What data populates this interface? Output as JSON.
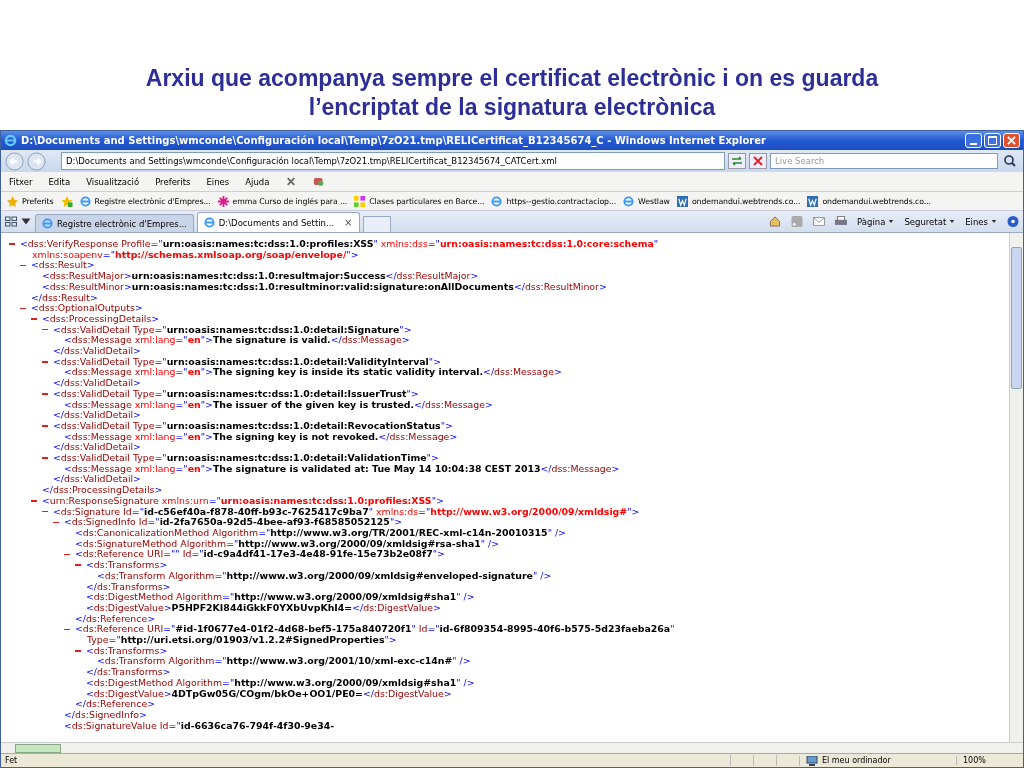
{
  "slide": {
    "title_lines": [
      "Arxiu que acompanya sempre el certificat electrònic i on es guarda",
      "l’encriptat de la signatura electrònica"
    ]
  },
  "browser": {
    "title": "D:\\Documents and Settings\\wmconde\\Configuración local\\Temp\\7zO21.tmp\\RELICertificat_B12345674_C - Windows Internet Explorer",
    "address": "D:\\Documents and Settings\\wmconde\\Configuración local\\Temp\\7zO21.tmp\\RELICertificat_B12345674_CATCert.xml",
    "search": {
      "placeholder": "Live Search"
    },
    "menu": [
      "Fitxer",
      "Edita",
      "Visualització",
      "Preferits",
      "Eines",
      "Ajuda"
    ],
    "favorites_button": "Preferits",
    "favorites": [
      {
        "label": "Registre electrònic d'Empres...",
        "kind": "page"
      },
      {
        "label": "emma Curso de inglés para ...",
        "kind": "asterisk"
      },
      {
        "label": "Clases particulares en Barce...",
        "kind": "squares"
      },
      {
        "label": "https--gestio.contractaciop...",
        "kind": "page"
      },
      {
        "label": "Westlaw",
        "kind": "page"
      },
      {
        "label": "ondemandui.webtrends.co...",
        "kind": "w"
      },
      {
        "label": "ondemandui.webtrends.co...",
        "kind": "w"
      }
    ],
    "tabs": [
      {
        "label": "Registre electrònic d'Empres...",
        "selected": false
      },
      {
        "label": "D:\\Documents and Settin...",
        "selected": true,
        "close": "×"
      }
    ],
    "commands": [
      "Pàgina",
      "Seguretat",
      "Eines"
    ],
    "status_bar": {
      "text": "Fet",
      "zone": "El meu ordinador",
      "zoom": "100%"
    }
  },
  "document": {
    "nodes": [
      {
        "expanded": true,
        "open": [
          [
            {
              "m": "<"
            },
            {
              "n": "dss:VerifyResponse"
            },
            {
              "a": " Profile"
            },
            {
              "m": "=\""
            },
            {
              "v": "urn:oasis:names:tc:dss:1.0:profiles:XSS"
            },
            {
              "m": "\""
            },
            {
              "x": " xmlns:dss"
            },
            {
              "m": "=\""
            },
            {
              "r": "urn:oasis:names:tc:dss:1.0:core:schema"
            },
            {
              "m": "\""
            }
          ],
          [
            {
              "x": "xmlns:soapenv"
            },
            {
              "m": "=\""
            },
            {
              "r": "http://schemas.xmlsoap.org/soap/envelope/"
            },
            {
              "m": "\">"
            }
          ]
        ],
        "children": [
          {
            "expanded": true,
            "open": [
              [
                {
                  "m": "<"
                },
                {
                  "n": "dss:Result"
                },
                {
                  "m": ">"
                }
              ]
            ],
            "children": [
              {
                "open": [
                  [
                    {
                      "m": "<"
                    },
                    {
                      "n": "dss:ResultMajor"
                    },
                    {
                      "m": ">"
                    },
                    {
                      "t": "urn:oasis:names:tc:dss:1.0:resultmajor:Success"
                    },
                    {
                      "m": "</"
                    },
                    {
                      "n": "dss:ResultMajor"
                    },
                    {
                      "m": ">"
                    }
                  ]
                ]
              },
              {
                "open": [
                  [
                    {
                      "m": "<"
                    },
                    {
                      "n": "dss:ResultMinor"
                    },
                    {
                      "m": ">"
                    },
                    {
                      "t": "urn:oasis:names:tc:dss:1.0:resultminor:valid:signature:onAllDocuments"
                    },
                    {
                      "m": "</"
                    },
                    {
                      "n": "dss:ResultMinor"
                    },
                    {
                      "m": ">"
                    }
                  ]
                ]
              }
            ],
            "close": [
              {
                "m": "</"
              },
              {
                "n": "dss:Result"
              },
              {
                "m": ">"
              }
            ]
          },
          {
            "expanded": true,
            "open": [
              [
                {
                  "m": "<"
                },
                {
                  "n": "dss:OptionalOutputs"
                },
                {
                  "m": ">"
                }
              ]
            ],
            "children": [
              {
                "expanded": true,
                "open": [
                  [
                    {
                      "m": "<"
                    },
                    {
                      "n": "dss:ProcessingDetails"
                    },
                    {
                      "m": ">"
                    }
                  ]
                ],
                "children": [
                  {
                    "expanded": true,
                    "open": [
                      [
                        {
                          "m": "<"
                        },
                        {
                          "n": "dss:ValidDetail"
                        },
                        {
                          "a": " Type"
                        },
                        {
                          "m": "=\""
                        },
                        {
                          "v": "urn:oasis:names:tc:dss:1.0:detail:Signature"
                        },
                        {
                          "m": "\">"
                        }
                      ]
                    ],
                    "children": [
                      {
                        "open": [
                          [
                            {
                              "m": "<"
                            },
                            {
                              "n": "dss:Message"
                            },
                            {
                              "x": " xml:lang"
                            },
                            {
                              "m": "=\""
                            },
                            {
                              "r": "en"
                            },
                            {
                              "m": "\">"
                            },
                            {
                              "t": "The signature is valid."
                            },
                            {
                              "m": "</"
                            },
                            {
                              "n": "dss:Message"
                            },
                            {
                              "m": ">"
                            }
                          ]
                        ]
                      }
                    ],
                    "close": [
                      {
                        "m": "</"
                      },
                      {
                        "n": "dss:ValidDetail"
                      },
                      {
                        "m": ">"
                      }
                    ]
                  },
                  {
                    "expanded": true,
                    "open": [
                      [
                        {
                          "m": "<"
                        },
                        {
                          "n": "dss:ValidDetail"
                        },
                        {
                          "a": " Type"
                        },
                        {
                          "m": "=\""
                        },
                        {
                          "v": "urn:oasis:names:tc:dss:1.0:detail:ValidityInterval"
                        },
                        {
                          "m": "\">"
                        }
                      ]
                    ],
                    "children": [
                      {
                        "open": [
                          [
                            {
                              "m": "<"
                            },
                            {
                              "n": "dss:Message"
                            },
                            {
                              "x": " xml:lang"
                            },
                            {
                              "m": "=\""
                            },
                            {
                              "r": "en"
                            },
                            {
                              "m": "\">"
                            },
                            {
                              "t": "The signing key is inside its static validity interval."
                            },
                            {
                              "m": "</"
                            },
                            {
                              "n": "dss:Message"
                            },
                            {
                              "m": ">"
                            }
                          ]
                        ]
                      }
                    ],
                    "close": [
                      {
                        "m": "</"
                      },
                      {
                        "n": "dss:ValidDetail"
                      },
                      {
                        "m": ">"
                      }
                    ]
                  },
                  {
                    "expanded": true,
                    "open": [
                      [
                        {
                          "m": "<"
                        },
                        {
                          "n": "dss:ValidDetail"
                        },
                        {
                          "a": " Type"
                        },
                        {
                          "m": "=\""
                        },
                        {
                          "v": "urn:oasis:names:tc:dss:1.0:detail:IssuerTrust"
                        },
                        {
                          "m": "\">"
                        }
                      ]
                    ],
                    "children": [
                      {
                        "open": [
                          [
                            {
                              "m": "<"
                            },
                            {
                              "n": "dss:Message"
                            },
                            {
                              "x": " xml:lang"
                            },
                            {
                              "m": "=\""
                            },
                            {
                              "r": "en"
                            },
                            {
                              "m": "\">"
                            },
                            {
                              "t": "The issuer of the given key is trusted."
                            },
                            {
                              "m": "</"
                            },
                            {
                              "n": "dss:Message"
                            },
                            {
                              "m": ">"
                            }
                          ]
                        ]
                      }
                    ],
                    "close": [
                      {
                        "m": "</"
                      },
                      {
                        "n": "dss:ValidDetail"
                      },
                      {
                        "m": ">"
                      }
                    ]
                  },
                  {
                    "expanded": true,
                    "open": [
                      [
                        {
                          "m": "<"
                        },
                        {
                          "n": "dss:ValidDetail"
                        },
                        {
                          "a": " Type"
                        },
                        {
                          "m": "=\""
                        },
                        {
                          "v": "urn:oasis:names:tc:dss:1.0:detail:RevocationStatus"
                        },
                        {
                          "m": "\">"
                        }
                      ]
                    ],
                    "children": [
                      {
                        "open": [
                          [
                            {
                              "m": "<"
                            },
                            {
                              "n": "dss:Message"
                            },
                            {
                              "x": " xml:lang"
                            },
                            {
                              "m": "=\""
                            },
                            {
                              "r": "en"
                            },
                            {
                              "m": "\">"
                            },
                            {
                              "t": "The signing key is not revoked."
                            },
                            {
                              "m": "</"
                            },
                            {
                              "n": "dss:Message"
                            },
                            {
                              "m": ">"
                            }
                          ]
                        ]
                      }
                    ],
                    "close": [
                      {
                        "m": "</"
                      },
                      {
                        "n": "dss:ValidDetail"
                      },
                      {
                        "m": ">"
                      }
                    ]
                  },
                  {
                    "expanded": true,
                    "open": [
                      [
                        {
                          "m": "<"
                        },
                        {
                          "n": "dss:ValidDetail"
                        },
                        {
                          "a": " Type"
                        },
                        {
                          "m": "=\""
                        },
                        {
                          "v": "urn:oasis:names:tc:dss:1.0:detail:ValidationTime"
                        },
                        {
                          "m": "\">"
                        }
                      ]
                    ],
                    "children": [
                      {
                        "open": [
                          [
                            {
                              "m": "<"
                            },
                            {
                              "n": "dss:Message"
                            },
                            {
                              "x": " xml:lang"
                            },
                            {
                              "m": "=\""
                            },
                            {
                              "r": "en"
                            },
                            {
                              "m": "\">"
                            },
                            {
                              "t": "The signature is validated at: Tue May 14 10:04:38 CEST 2013"
                            },
                            {
                              "m": "</"
                            },
                            {
                              "n": "dss:Message"
                            },
                            {
                              "m": ">"
                            }
                          ]
                        ]
                      }
                    ],
                    "close": [
                      {
                        "m": "</"
                      },
                      {
                        "n": "dss:ValidDetail"
                      },
                      {
                        "m": ">"
                      }
                    ]
                  }
                ],
                "close": [
                  {
                    "m": "</"
                  },
                  {
                    "n": "dss:ProcessingDetails"
                  },
                  {
                    "m": ">"
                  }
                ]
              },
              {
                "expanded": true,
                "open": [
                  [
                    {
                      "m": "<"
                    },
                    {
                      "n": "urn:ResponseSignature"
                    },
                    {
                      "x": " xmlns:urn"
                    },
                    {
                      "m": "=\""
                    },
                    {
                      "r": "urn:oasis:names:tc:dss:1.0:profiles:XSS"
                    },
                    {
                      "m": "\">"
                    }
                  ]
                ],
                "children": [
                  {
                    "expanded": true,
                    "open": [
                      [
                        {
                          "m": "<"
                        },
                        {
                          "n": "ds:Signature"
                        },
                        {
                          "a": " Id"
                        },
                        {
                          "m": "=\""
                        },
                        {
                          "v": "id-c56ef40a-f878-40ff-b93c-7625417c9ba7"
                        },
                        {
                          "m": "\""
                        },
                        {
                          "x": " xmlns:ds"
                        },
                        {
                          "m": "=\""
                        },
                        {
                          "r": "http://www.w3.org/2000/09/xmldsig#"
                        },
                        {
                          "m": "\">"
                        }
                      ]
                    ],
                    "children": [
                      {
                        "expanded": true,
                        "open": [
                          [
                            {
                              "m": "<"
                            },
                            {
                              "n": "ds:SignedInfo"
                            },
                            {
                              "a": " Id"
                            },
                            {
                              "m": "=\""
                            },
                            {
                              "v": "id-2fa7650a-92d5-4bee-af93-f68585052125"
                            },
                            {
                              "m": "\">"
                            }
                          ]
                        ],
                        "children": [
                          {
                            "open": [
                              [
                                {
                                  "m": "<"
                                },
                                {
                                  "n": "ds:CanonicalizationMethod"
                                },
                                {
                                  "a": " Algorithm"
                                },
                                {
                                  "m": "=\""
                                },
                                {
                                  "v": "http://www.w3.org/TR/2001/REC-xml-c14n-20010315"
                                },
                                {
                                  "m": "\" />"
                                }
                              ]
                            ]
                          },
                          {
                            "open": [
                              [
                                {
                                  "m": "<"
                                },
                                {
                                  "n": "ds:SignatureMethod"
                                },
                                {
                                  "a": " Algorithm"
                                },
                                {
                                  "m": "=\""
                                },
                                {
                                  "v": "http://www.w3.org/2000/09/xmldsig#rsa-sha1"
                                },
                                {
                                  "m": "\" />"
                                }
                              ]
                            ]
                          },
                          {
                            "expanded": true,
                            "open": [
                              [
                                {
                                  "m": "<"
                                },
                                {
                                  "n": "ds:Reference"
                                },
                                {
                                  "a": " URI"
                                },
                                {
                                  "m": "=\"\""
                                },
                                {
                                  "a": " Id"
                                },
                                {
                                  "m": "=\""
                                },
                                {
                                  "v": "id-c9a4df41-17e3-4e48-91fe-15e73b2e08f7"
                                },
                                {
                                  "m": "\">"
                                }
                              ]
                            ],
                            "children": [
                              {
                                "expanded": true,
                                "open": [
                                  [
                                    {
                                      "m": "<"
                                    },
                                    {
                                      "n": "ds:Transforms"
                                    },
                                    {
                                      "m": ">"
                                    }
                                  ]
                                ],
                                "children": [
                                  {
                                    "open": [
                                      [
                                        {
                                          "m": "<"
                                        },
                                        {
                                          "n": "ds:Transform"
                                        },
                                        {
                                          "a": " Algorithm"
                                        },
                                        {
                                          "m": "=\""
                                        },
                                        {
                                          "v": "http://www.w3.org/2000/09/xmldsig#enveloped-signature"
                                        },
                                        {
                                          "m": "\" />"
                                        }
                                      ]
                                    ]
                                  }
                                ],
                                "close": [
                                  {
                                    "m": "</"
                                  },
                                  {
                                    "n": "ds:Transforms"
                                  },
                                  {
                                    "m": ">"
                                  }
                                ]
                              },
                              {
                                "open": [
                                  [
                                    {
                                      "m": "<"
                                    },
                                    {
                                      "n": "ds:DigestMethod"
                                    },
                                    {
                                      "a": " Algorithm"
                                    },
                                    {
                                      "m": "=\""
                                    },
                                    {
                                      "v": "http://www.w3.org/2000/09/xmldsig#sha1"
                                    },
                                    {
                                      "m": "\" />"
                                    }
                                  ]
                                ]
                              },
                              {
                                "open": [
                                  [
                                    {
                                      "m": "<"
                                    },
                                    {
                                      "n": "ds:DigestValue"
                                    },
                                    {
                                      "m": ">"
                                    },
                                    {
                                      "t": "P5HPF2KI844iGkkF0YXbUvpKhI4="
                                    },
                                    {
                                      "m": "</"
                                    },
                                    {
                                      "n": "ds:DigestValue"
                                    },
                                    {
                                      "m": ">"
                                    }
                                  ]
                                ]
                              }
                            ],
                            "close": [
                              {
                                "m": "</"
                              },
                              {
                                "n": "ds:Reference"
                              },
                              {
                                "m": ">"
                              }
                            ]
                          },
                          {
                            "expanded": true,
                            "open": [
                              [
                                {
                                  "m": "<"
                                },
                                {
                                  "n": "ds:Reference"
                                },
                                {
                                  "a": " URI"
                                },
                                {
                                  "m": "=\""
                                },
                                {
                                  "v": "#id-1f0677e4-01f2-4d68-bef5-175a840720f1"
                                },
                                {
                                  "m": "\""
                                },
                                {
                                  "a": " Id"
                                },
                                {
                                  "m": "=\""
                                },
                                {
                                  "v": "id-6f809354-8995-40f6-b575-5d23faeba26a"
                                },
                                {
                                  "m": "\""
                                }
                              ],
                              [
                                {
                                  "a": "Type"
                                },
                                {
                                  "m": "=\""
                                },
                                {
                                  "v": "http://uri.etsi.org/01903/v1.2.2#SignedProperties"
                                },
                                {
                                  "m": "\">"
                                }
                              ]
                            ],
                            "children": [
                              {
                                "expanded": true,
                                "open": [
                                  [
                                    {
                                      "m": "<"
                                    },
                                    {
                                      "n": "ds:Transforms"
                                    },
                                    {
                                      "m": ">"
                                    }
                                  ]
                                ],
                                "children": [
                                  {
                                    "open": [
                                      [
                                        {
                                          "m": "<"
                                        },
                                        {
                                          "n": "ds:Transform"
                                        },
                                        {
                                          "a": " Algorithm"
                                        },
                                        {
                                          "m": "=\""
                                        },
                                        {
                                          "v": "http://www.w3.org/2001/10/xml-exc-c14n#"
                                        },
                                        {
                                          "m": "\" />"
                                        }
                                      ]
                                    ]
                                  }
                                ],
                                "close": [
                                  {
                                    "m": "</"
                                  },
                                  {
                                    "n": "ds:Transforms"
                                  },
                                  {
                                    "m": ">"
                                  }
                                ]
                              },
                              {
                                "open": [
                                  [
                                    {
                                      "m": "<"
                                    },
                                    {
                                      "n": "ds:DigestMethod"
                                    },
                                    {
                                      "a": " Algorithm"
                                    },
                                    {
                                      "m": "=\""
                                    },
                                    {
                                      "v": "http://www.w3.org/2000/09/xmldsig#sha1"
                                    },
                                    {
                                      "m": "\" />"
                                    }
                                  ]
                                ]
                              },
                              {
                                "open": [
                                  [
                                    {
                                      "m": "<"
                                    },
                                    {
                                      "n": "ds:DigestValue"
                                    },
                                    {
                                      "m": ">"
                                    },
                                    {
                                      "t": "4DTpGw05G/COgm/bkOe+OO1/PE0="
                                    },
                                    {
                                      "m": "</"
                                    },
                                    {
                                      "n": "ds:DigestValue"
                                    },
                                    {
                                      "m": ">"
                                    }
                                  ]
                                ]
                              }
                            ],
                            "close": [
                              {
                                "m": "</"
                              },
                              {
                                "n": "ds:Reference"
                              },
                              {
                                "m": ">"
                              }
                            ]
                          }
                        ],
                        "close": [
                          {
                            "m": "</"
                          },
                          {
                            "n": "ds:SignedInfo"
                          },
                          {
                            "m": ">"
                          }
                        ]
                      },
                      {
                        "open": [
                          [
                            {
                              "m": "<"
                            },
                            {
                              "n": "ds:SignatureValue"
                            },
                            {
                              "a": " Id"
                            },
                            {
                              "m": "=\""
                            },
                            {
                              "v": "id-6636ca76-794f-4f30-9e34-"
                            }
                          ]
                        ]
                      }
                    ]
                  }
                ]
              }
            ]
          }
        ]
      }
    ]
  }
}
